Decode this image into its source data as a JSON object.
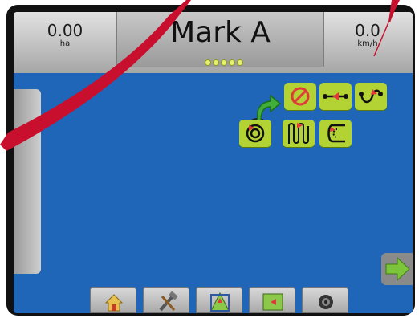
{
  "topbar": {
    "area_value": "0.00",
    "area_unit": "ha",
    "title": "Mark A",
    "speed_value": "0.0",
    "speed_unit": "km/h",
    "indicator_dots": 5
  },
  "guidance_buttons": [
    {
      "name": "return-to-point-button",
      "icon": "curved-arrow-icon"
    },
    {
      "name": "no-guidance-button",
      "icon": "prohibit-icon"
    },
    {
      "name": "straight-ab-button",
      "icon": "straight-line-icon"
    },
    {
      "name": "curved-ab-button",
      "icon": "curve-line-icon"
    },
    {
      "name": "circle-pivot-button",
      "icon": "circle-icon"
    },
    {
      "name": "adaptive-curve-button",
      "icon": "adaptive-curve-icon"
    },
    {
      "name": "last-pass-button",
      "icon": "last-pass-icon"
    }
  ],
  "bottom_tabs": [
    {
      "name": "home-tab",
      "icon": "home-icon"
    },
    {
      "name": "tools-tab",
      "icon": "tools-icon"
    },
    {
      "name": "vehicle-view-tab",
      "icon": "vehicle-view-icon"
    },
    {
      "name": "field-view-tab",
      "icon": "field-view-icon"
    },
    {
      "name": "camera-tab",
      "icon": "camera-icon"
    }
  ],
  "colors": {
    "screen_blue": "#1f66b8",
    "button_green": "#b3d334",
    "marker_red": "#e03a3a",
    "annotation_red": "#c8102e"
  }
}
